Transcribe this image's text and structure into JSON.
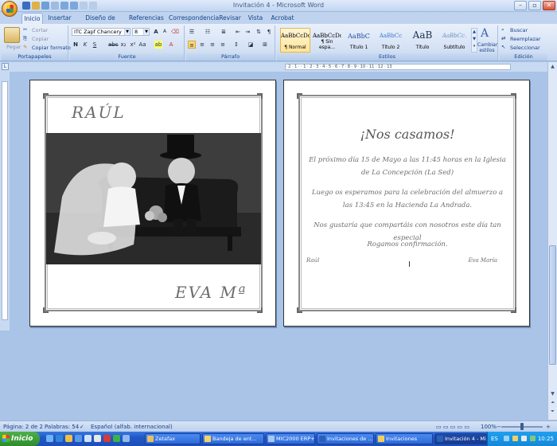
{
  "window": {
    "title": "Invitación 4 - Microsoft Word"
  },
  "tabs": [
    "Inicio",
    "Insertar",
    "Diseño de página",
    "Referencias",
    "Correspondencia",
    "Revisar",
    "Vista",
    "Acrobat"
  ],
  "ribbon": {
    "clipboard": {
      "label": "Portapapeles",
      "paste": "Pegar",
      "cut": "Cortar",
      "copy": "Copiar",
      "format_painter": "Copiar formato"
    },
    "font": {
      "label": "Fuente",
      "font_name": "ITC Zapf Chancery",
      "font_size": "8"
    },
    "paragraph": {
      "label": "Párrafo"
    },
    "styles": {
      "label": "Estilos",
      "items": [
        {
          "sample": "AaBbCcDc",
          "name": "¶ Normal"
        },
        {
          "sample": "AaBbCcDc",
          "name": "¶ Sin espa..."
        },
        {
          "sample": "AaBbC",
          "name": "Título 1"
        },
        {
          "sample": "AaBbCc",
          "name": "Título 2"
        },
        {
          "sample": "AaB",
          "name": "Título"
        },
        {
          "sample": "AaBbCc.",
          "name": "Subtítulo"
        }
      ],
      "change_styles": "Cambiar estilos"
    },
    "editing": {
      "label": "Edición",
      "find": "Buscar",
      "replace": "Reemplazar",
      "select": "Seleccionar"
    }
  },
  "ruler": {
    "ticks": "· 2 · 1 · · 1 · 2 · 3 · 4 · 5 · 6 · 7 · 8 · 9 · 10 · 11 · 12 · 13"
  },
  "left_card": {
    "name_top": "RAÚL",
    "name_bottom": "EVA Mª"
  },
  "right_card": {
    "heading": "¡Nos casamos!",
    "para1": "El próximo día 15 de Mayo a las 11:45 horas en la Iglesia de La Concepción (La Sed)",
    "para2": "Luego os esperamos para la celebración del almuerzo a las 13:45 en la Hacienda La Andrada.",
    "para3": "Nos gustaría que compartáis con nosotros este día tan especial",
    "para4": "Rogamos confirmación.",
    "sign_left": "Raúl",
    "sign_right": "Eva María"
  },
  "status": {
    "page": "Página: 2 de 2",
    "words": "Palabras: 54",
    "language": "Español (alfab. internacional)",
    "zoom": "100%"
  },
  "taskbar": {
    "start": "Inicio",
    "tasks": [
      "Zetafax",
      "Bandeja de ent...",
      "MIC2000 ERP+",
      "Invitaciones de ...",
      "Invitaciones",
      "Invitación 4 - Mi..."
    ],
    "lang": "ES",
    "clock": "10:25"
  },
  "colors": {
    "accent": "#15428b",
    "workspace": "#a9c4e6",
    "taskbar": "#2157c6"
  }
}
